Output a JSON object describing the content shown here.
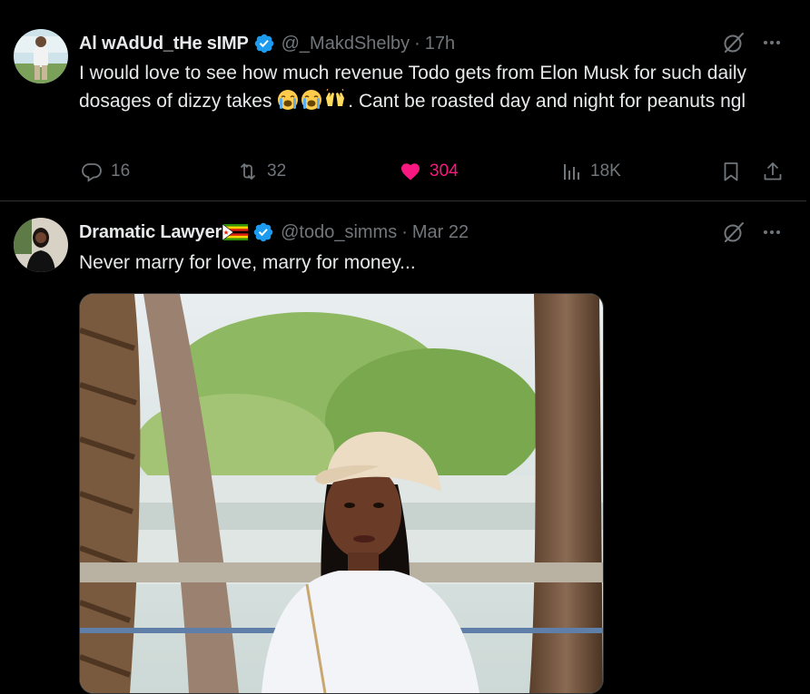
{
  "tweets": [
    {
      "display_name": "Al wAdUd_tHe sIMP",
      "handle": "@_MakdShelby",
      "separator": "·",
      "time": "17h",
      "text_before_emoji": "I would love to see how much revenue Todo gets from Elon Musk for such daily dosages of dizzy takes ",
      "emojis": [
        "loudly-crying-face",
        "loudly-crying-face",
        "raising-hands"
      ],
      "text_after_emoji": ". Cant be roasted day and night for peanuts ngl",
      "stats": {
        "replies": "16",
        "retweets": "32",
        "likes": "304",
        "views": "18K"
      },
      "liked": true
    },
    {
      "display_name": "Dramatic Lawyer",
      "name_flag": "zimbabwe-flag",
      "handle": "@todo_simms",
      "separator": "·",
      "time": "Mar 22",
      "text": "Never marry for love, marry for money...",
      "media": "photo-woman-white-cap-outdoors"
    }
  ],
  "icons": {
    "verified": "verified-badge-icon",
    "grok": "grok-icon",
    "more": "more-icon",
    "reply": "reply-icon",
    "retweet": "retweet-icon",
    "like": "heart-icon",
    "views": "views-icon",
    "bookmark": "bookmark-icon",
    "share": "share-icon"
  },
  "colors": {
    "background": "#000000",
    "text_primary": "#e7e9ea",
    "text_secondary": "#71767b",
    "verified_blue": "#1d9bf0",
    "like_pink": "#f91880",
    "divider": "#2f3336"
  }
}
